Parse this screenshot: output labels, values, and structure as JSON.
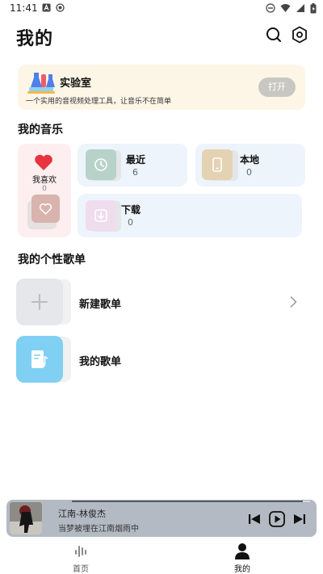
{
  "status_bar": {
    "time": "11:41"
  },
  "header": {
    "title": "我的"
  },
  "lab": {
    "title": "实验室",
    "description": "一个实用的音视频处理工具，让音乐不在简单",
    "open_label": "打开"
  },
  "my_music": {
    "title": "我的音乐",
    "liked": {
      "label": "我喜欢",
      "count": "0"
    },
    "tiles": [
      {
        "label": "最近",
        "count": "6",
        "icon": "clock-icon"
      },
      {
        "label": "本地",
        "count": "0",
        "icon": "phone-icon"
      },
      {
        "label": "下载",
        "count": "0",
        "icon": "download-icon"
      }
    ]
  },
  "playlists": {
    "title": "我的个性歌单",
    "items": [
      {
        "label": "新建歌单",
        "icon": "plus-icon"
      },
      {
        "label": "我的歌单",
        "icon": "playlist-icon"
      }
    ]
  },
  "player": {
    "song": "江南-林俊杰",
    "lyric": "当梦被埋在江南烟雨中",
    "progress": 0.97
  },
  "nav": {
    "items": [
      {
        "label": "首页"
      },
      {
        "label": "我的"
      }
    ]
  },
  "colors": {
    "accent_red": "#e8343f",
    "lab_bg": "#fdf6e7",
    "tile_bg": "#edf4fb",
    "liked_bg": "#fdeef0"
  }
}
